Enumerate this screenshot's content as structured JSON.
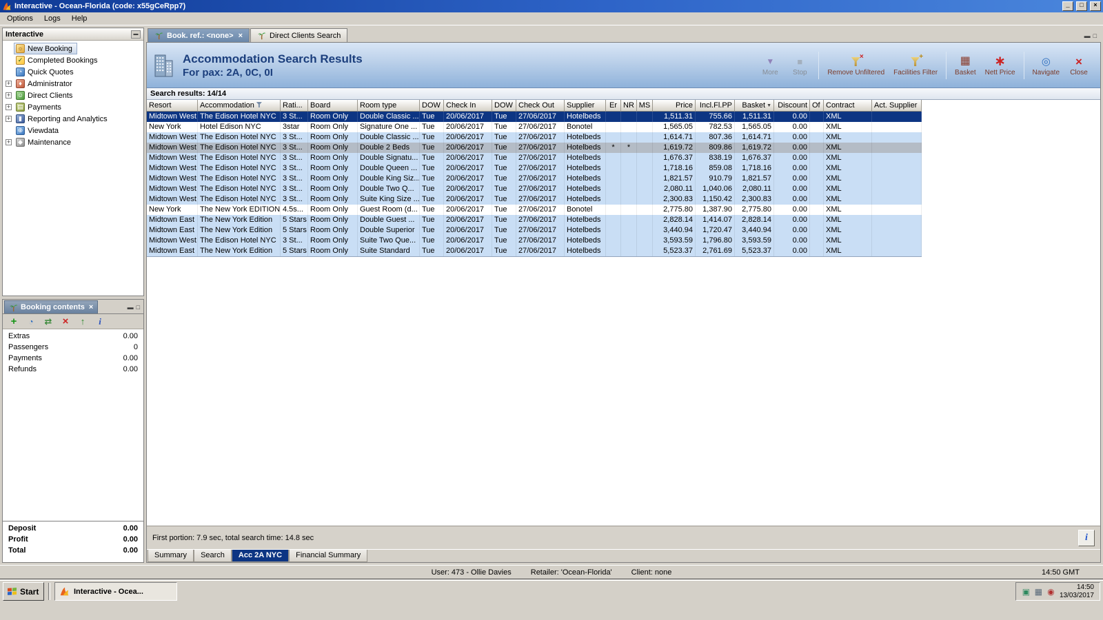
{
  "window": {
    "title": "Interactive - Ocean-Florida (code: x55gCeRpp7)",
    "controls": {
      "minimize": "_",
      "maximize": "□",
      "close": "×"
    }
  },
  "menubar": {
    "items": [
      "Options",
      "Logs",
      "Help"
    ]
  },
  "sidebar": {
    "title": "Interactive",
    "items": [
      {
        "label": "New Booking",
        "icon": "new-booking-icon",
        "expandable": false,
        "selected": true
      },
      {
        "label": "Completed Bookings",
        "icon": "completed-bookings-icon",
        "expandable": false,
        "selected": false
      },
      {
        "label": "Quick Quotes",
        "icon": "quick-quotes-icon",
        "expandable": false,
        "selected": false
      },
      {
        "label": "Administrator",
        "icon": "administrator-icon",
        "expandable": true,
        "selected": false
      },
      {
        "label": "Direct Clients",
        "icon": "direct-clients-icon",
        "expandable": true,
        "selected": false
      },
      {
        "label": "Payments",
        "icon": "payments-icon",
        "expandable": true,
        "selected": false
      },
      {
        "label": "Reporting and Analytics",
        "icon": "reporting-analytics-icon",
        "expandable": true,
        "selected": false
      },
      {
        "label": "Viewdata",
        "icon": "viewdata-icon",
        "expandable": false,
        "selected": false
      },
      {
        "label": "Maintenance",
        "icon": "maintenance-icon",
        "expandable": true,
        "selected": false
      }
    ]
  },
  "booking_contents": {
    "tab_label": "Booking contents",
    "toolbar_icons": [
      "add-icon",
      "clock-icon",
      "transfer-icon",
      "delete-icon",
      "export-icon",
      "info-icon"
    ],
    "rows": [
      {
        "label": "Extras",
        "value": "0.00"
      },
      {
        "label": "Passengers",
        "value": "0"
      },
      {
        "label": "Payments",
        "value": "0.00"
      },
      {
        "label": "Refunds",
        "value": "0.00"
      }
    ],
    "totals": [
      {
        "label": "Deposit",
        "value": "0.00"
      },
      {
        "label": "Profit",
        "value": "0.00"
      },
      {
        "label": "Total",
        "value": "0.00"
      }
    ]
  },
  "main": {
    "doc_tabs": [
      {
        "label": "Book. ref.: <none>",
        "icon": "palm-icon",
        "active": true,
        "closable": true
      },
      {
        "label": "Direct Clients Search",
        "icon": "palm-icon",
        "active": false,
        "closable": false
      }
    ],
    "header": {
      "icon": "building-icon",
      "title": "Accommodation Search Results",
      "subtitle": "For pax: 2A, 0C, 0I",
      "tools": [
        {
          "label": "More",
          "icon": "more-icon",
          "disabled": true,
          "group_end": false
        },
        {
          "label": "Stop",
          "icon": "stop-icon",
          "disabled": true,
          "group_end": true
        },
        {
          "label": "Remove Unfiltered",
          "icon": "remove-filter-icon",
          "disabled": false,
          "group_end": false
        },
        {
          "label": "Facilities Filter",
          "icon": "facilities-filter-icon",
          "disabled": false,
          "group_end": true
        },
        {
          "label": "Basket",
          "icon": "basket-icon",
          "disabled": false,
          "group_end": false
        },
        {
          "label": "Nett Price",
          "icon": "nett-price-icon",
          "disabled": false,
          "group_end": true
        },
        {
          "label": "Navigate",
          "icon": "navigate-icon",
          "disabled": false,
          "group_end": false
        },
        {
          "label": "Close",
          "icon": "close-tool-icon",
          "disabled": false,
          "group_end": false
        }
      ]
    },
    "results_label": "Search results: 14/14",
    "table": {
      "columns": [
        {
          "label": "Resort"
        },
        {
          "label": "Accommodation",
          "filter": true
        },
        {
          "label": "Rati..."
        },
        {
          "label": "Board"
        },
        {
          "label": "Room type"
        },
        {
          "label": "DOW"
        },
        {
          "label": "Check In"
        },
        {
          "label": "DOW"
        },
        {
          "label": "Check Out"
        },
        {
          "label": "Supplier"
        },
        {
          "label": "Er"
        },
        {
          "label": "NR"
        },
        {
          "label": "MS"
        },
        {
          "label": "Price"
        },
        {
          "label": "Incl.Fl.PP"
        },
        {
          "label": "Basket",
          "sort": true
        },
        {
          "label": "Discount"
        },
        {
          "label": "Of"
        },
        {
          "label": "Contract"
        },
        {
          "label": "Act. Supplier"
        }
      ],
      "rows": [
        {
          "style": "selected",
          "cells": [
            "Midtown West",
            "The Edison Hotel NYC",
            "3 St...",
            "Room Only",
            "Double Classic ...",
            "Tue",
            "20/06/2017",
            "Tue",
            "27/06/2017",
            "Hotelbeds",
            "",
            "",
            "",
            "1,511.31",
            "755.66",
            "1,511.31",
            "0.00",
            "",
            "XML",
            ""
          ]
        },
        {
          "style": "white",
          "cells": [
            "New York",
            "Hotel Edison NYC",
            "3star",
            "Room Only",
            "Signature One ...",
            "Tue",
            "20/06/2017",
            "Tue",
            "27/06/2017",
            "Bonotel",
            "",
            "",
            "",
            "1,565.05",
            "782.53",
            "1,565.05",
            "0.00",
            "",
            "XML",
            ""
          ]
        },
        {
          "style": "blue",
          "cells": [
            "Midtown West",
            "The Edison Hotel NYC",
            "3 St...",
            "Room Only",
            "Double Classic ...",
            "Tue",
            "20/06/2017",
            "Tue",
            "27/06/2017",
            "Hotelbeds",
            "",
            "",
            "",
            "1,614.71",
            "807.36",
            "1,614.71",
            "0.00",
            "",
            "XML",
            ""
          ]
        },
        {
          "style": "gray",
          "cells": [
            "Midtown West",
            "The Edison Hotel NYC",
            "3 St...",
            "Room Only",
            "Double 2 Beds",
            "Tue",
            "20/06/2017",
            "Tue",
            "27/06/2017",
            "Hotelbeds",
            "*",
            "*",
            "",
            "1,619.72",
            "809.86",
            "1,619.72",
            "0.00",
            "",
            "XML",
            ""
          ]
        },
        {
          "style": "blue",
          "cells": [
            "Midtown West",
            "The Edison Hotel NYC",
            "3 St...",
            "Room Only",
            "Double Signatu...",
            "Tue",
            "20/06/2017",
            "Tue",
            "27/06/2017",
            "Hotelbeds",
            "",
            "",
            "",
            "1,676.37",
            "838.19",
            "1,676.37",
            "0.00",
            "",
            "XML",
            ""
          ]
        },
        {
          "style": "blue",
          "cells": [
            "Midtown West",
            "The Edison Hotel NYC",
            "3 St...",
            "Room Only",
            "Double Queen ...",
            "Tue",
            "20/06/2017",
            "Tue",
            "27/06/2017",
            "Hotelbeds",
            "",
            "",
            "",
            "1,718.16",
            "859.08",
            "1,718.16",
            "0.00",
            "",
            "XML",
            ""
          ]
        },
        {
          "style": "blue",
          "cells": [
            "Midtown West",
            "The Edison Hotel NYC",
            "3 St...",
            "Room Only",
            "Double King Siz...",
            "Tue",
            "20/06/2017",
            "Tue",
            "27/06/2017",
            "Hotelbeds",
            "",
            "",
            "",
            "1,821.57",
            "910.79",
            "1,821.57",
            "0.00",
            "",
            "XML",
            ""
          ]
        },
        {
          "style": "blue",
          "cells": [
            "Midtown West",
            "The Edison Hotel NYC",
            "3 St...",
            "Room Only",
            "Double Two Q...",
            "Tue",
            "20/06/2017",
            "Tue",
            "27/06/2017",
            "Hotelbeds",
            "",
            "",
            "",
            "2,080.11",
            "1,040.06",
            "2,080.11",
            "0.00",
            "",
            "XML",
            ""
          ]
        },
        {
          "style": "blue",
          "cells": [
            "Midtown West",
            "The Edison Hotel NYC",
            "3 St...",
            "Room Only",
            "Suite King Size ...",
            "Tue",
            "20/06/2017",
            "Tue",
            "27/06/2017",
            "Hotelbeds",
            "",
            "",
            "",
            "2,300.83",
            "1,150.42",
            "2,300.83",
            "0.00",
            "",
            "XML",
            ""
          ]
        },
        {
          "style": "white",
          "cells": [
            "New York",
            "The New York EDITION",
            "4.5s...",
            "Room Only",
            "Guest Room (d...",
            "Tue",
            "20/06/2017",
            "Tue",
            "27/06/2017",
            "Bonotel",
            "",
            "",
            "",
            "2,775.80",
            "1,387.90",
            "2,775.80",
            "0.00",
            "",
            "XML",
            ""
          ]
        },
        {
          "style": "blue",
          "cells": [
            "Midtown East",
            "The New York Edition",
            "5 Stars",
            "Room Only",
            "Double Guest ...",
            "Tue",
            "20/06/2017",
            "Tue",
            "27/06/2017",
            "Hotelbeds",
            "",
            "",
            "",
            "2,828.14",
            "1,414.07",
            "2,828.14",
            "0.00",
            "",
            "XML",
            ""
          ]
        },
        {
          "style": "blue",
          "cells": [
            "Midtown East",
            "The New York Edition",
            "5 Stars",
            "Room Only",
            "Double Superior",
            "Tue",
            "20/06/2017",
            "Tue",
            "27/06/2017",
            "Hotelbeds",
            "",
            "",
            "",
            "3,440.94",
            "1,720.47",
            "3,440.94",
            "0.00",
            "",
            "XML",
            ""
          ]
        },
        {
          "style": "blue",
          "cells": [
            "Midtown West",
            "The Edison Hotel NYC",
            "3 St...",
            "Room Only",
            "Suite Two Que...",
            "Tue",
            "20/06/2017",
            "Tue",
            "27/06/2017",
            "Hotelbeds",
            "",
            "",
            "",
            "3,593.59",
            "1,796.80",
            "3,593.59",
            "0.00",
            "",
            "XML",
            ""
          ]
        },
        {
          "style": "blue",
          "cells": [
            "Midtown East",
            "The New York Edition",
            "5 Stars",
            "Room Only",
            "Suite Standard",
            "Tue",
            "20/06/2017",
            "Tue",
            "27/06/2017",
            "Hotelbeds",
            "",
            "",
            "",
            "5,523.37",
            "2,761.69",
            "5,523.37",
            "0.00",
            "",
            "XML",
            ""
          ]
        }
      ]
    },
    "timing": "First portion: 7.9 sec, total search time: 14.8 sec",
    "info_button": "i",
    "bottom_tabs": [
      {
        "label": "Summary",
        "active": false
      },
      {
        "label": "Search",
        "active": false
      },
      {
        "label": "Acc 2A NYC",
        "active": true
      },
      {
        "label": "Financial Summary",
        "active": false
      }
    ]
  },
  "statusbar": {
    "user": "User: 473 - Ollie Davies",
    "retailer": "Retailer: 'Ocean-Florida'",
    "client": "Client: none",
    "time": "14:50 GMT"
  },
  "taskbar": {
    "start_label": "Start",
    "tasks": [
      {
        "label": "Interactive - Ocea...",
        "icon": "task-app-icon",
        "active": true
      }
    ],
    "tray_icons": [
      "network-icon",
      "display-icon",
      "alert-icon"
    ],
    "clock_time": "14:50",
    "clock_date": "13/03/2017"
  },
  "colors": {
    "titlebar_blue": "#2e64c8",
    "selected_row": "#0d3583",
    "row_blue": "#c9def5",
    "row_gray": "#b4bcc6",
    "header_top": "#d9e6f6",
    "header_bottom": "#8fb2da"
  }
}
